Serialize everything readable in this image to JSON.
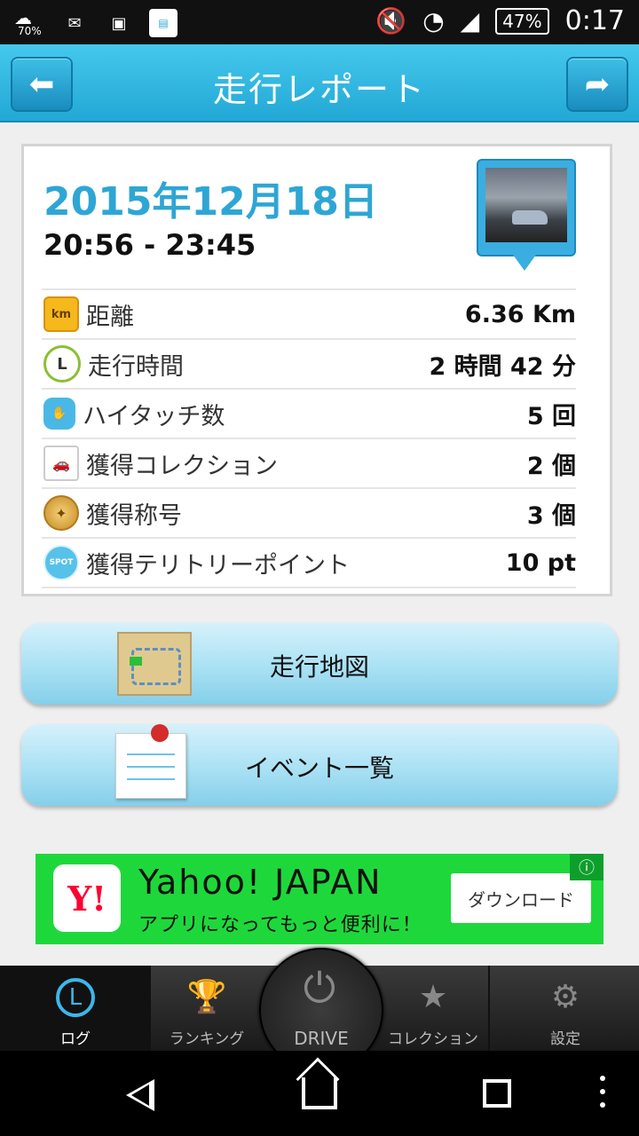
{
  "status_bar": {
    "weather_pct": "70%",
    "battery": "47%",
    "time": "0:17"
  },
  "header": {
    "title": "走行レポート"
  },
  "report": {
    "date": "2015年12月18日",
    "time_range": "20:56 - 23:45",
    "rows": [
      {
        "icon": "km-icon",
        "label": "距離",
        "value": "6.36 Km"
      },
      {
        "icon": "clock-icon",
        "label": "走行時間",
        "value": "2 時間 42 分"
      },
      {
        "icon": "hand-icon",
        "label": "ハイタッチ数",
        "value": "5 回"
      },
      {
        "icon": "car-icon",
        "label": "獲得コレクション",
        "value": "2 個"
      },
      {
        "icon": "medal-icon",
        "label": "獲得称号",
        "value": "3 個"
      },
      {
        "icon": "spot-icon",
        "label": "獲得テリトリーポイント",
        "value": "10 pt"
      }
    ]
  },
  "buttons": {
    "map_label": "走行地図",
    "events_label": "イベント一覧"
  },
  "ad": {
    "logo": "Y!",
    "title": "Yahoo! JAPAN",
    "subtitle": "アプリになってもっと便利に！",
    "button": "ダウンロード"
  },
  "tabs": {
    "log": "ログ",
    "ranking": "ランキング",
    "drive": "DRIVE",
    "collection": "コレクション",
    "settings": "設定"
  },
  "colors": {
    "accent": "#2ea6d4",
    "header": "#22a8d6",
    "ad_green": "#1ed83b"
  }
}
